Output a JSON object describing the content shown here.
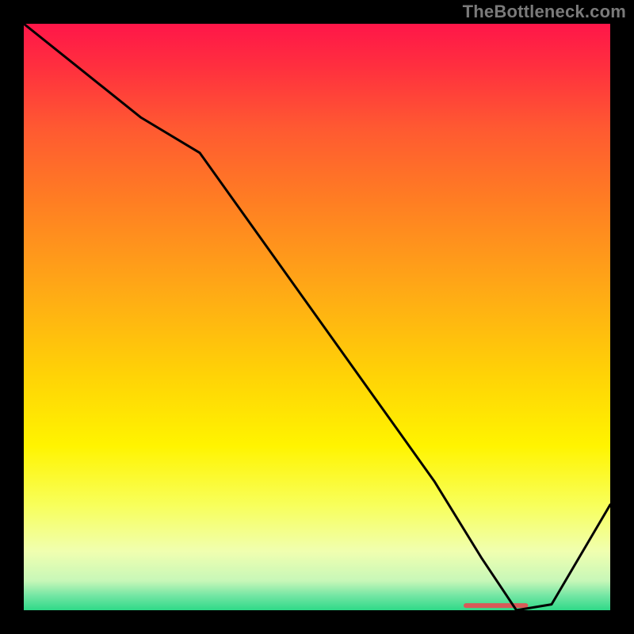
{
  "watermark": "TheBottleneck.com",
  "chart_data": {
    "type": "line",
    "title": "",
    "xlabel": "",
    "ylabel": "",
    "xlim": [
      0,
      100
    ],
    "ylim": [
      0,
      100
    ],
    "line": {
      "x": [
        0,
        10,
        20,
        30,
        40,
        50,
        60,
        70,
        78,
        84,
        90,
        100
      ],
      "y": [
        100,
        92,
        84,
        78,
        64,
        50,
        36,
        22,
        9,
        0,
        1,
        18
      ]
    },
    "marker": {
      "x_start": 75,
      "x_end": 86,
      "y": 0.8
    },
    "gradient_stops": [
      {
        "offset": 0.0,
        "color": "#ff1649"
      },
      {
        "offset": 0.07,
        "color": "#ff2e3f"
      },
      {
        "offset": 0.18,
        "color": "#ff5a31"
      },
      {
        "offset": 0.3,
        "color": "#ff7d23"
      },
      {
        "offset": 0.45,
        "color": "#ffa816"
      },
      {
        "offset": 0.6,
        "color": "#ffd306"
      },
      {
        "offset": 0.72,
        "color": "#fff400"
      },
      {
        "offset": 0.82,
        "color": "#f8ff5a"
      },
      {
        "offset": 0.9,
        "color": "#f0ffb0"
      },
      {
        "offset": 0.95,
        "color": "#c7f7b8"
      },
      {
        "offset": 0.975,
        "color": "#74e6a4"
      },
      {
        "offset": 1.0,
        "color": "#2fd988"
      }
    ],
    "marker_color": "#d85a58",
    "line_color": "#000000",
    "line_width": 3
  }
}
